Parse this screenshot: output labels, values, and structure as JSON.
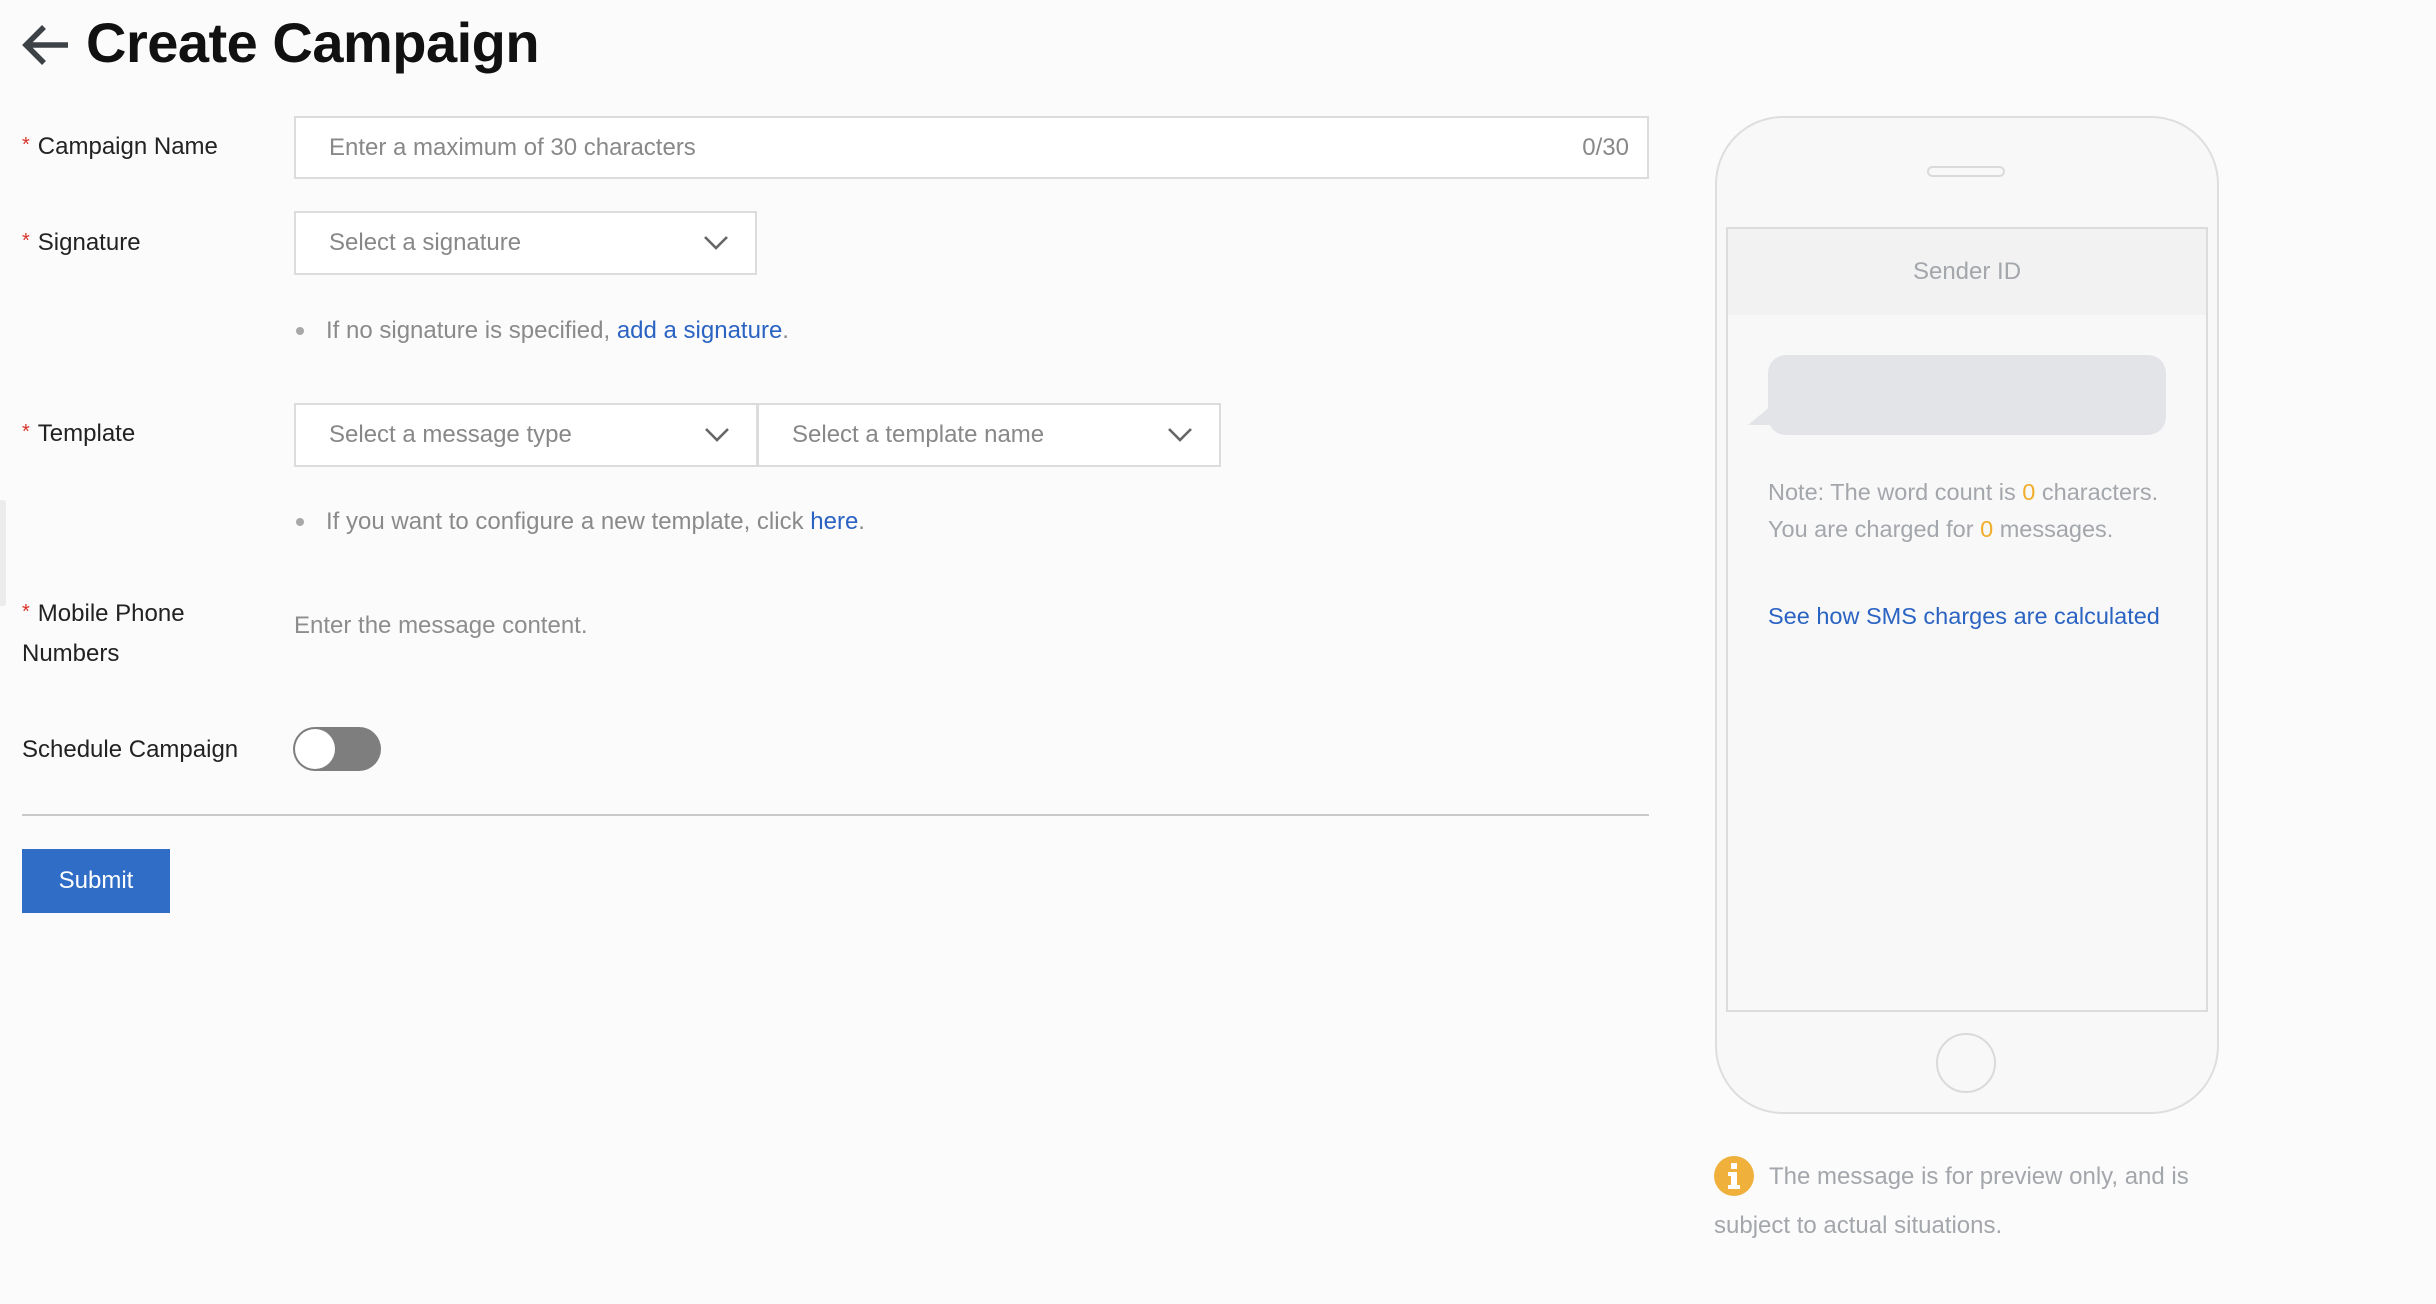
{
  "header": {
    "back_icon": "arrow-left-icon",
    "title": "Create Campaign"
  },
  "form": {
    "required_mark": "*",
    "campaign_name": {
      "label": "Campaign Name",
      "placeholder": "Enter a maximum of 30 characters",
      "value": "",
      "counter": "0/30"
    },
    "signature": {
      "label": "Signature",
      "placeholder": "Select a signature",
      "hint_text": "If no signature is specified, ",
      "hint_link": "add a signature",
      "hint_end": "."
    },
    "template": {
      "label": "Template",
      "type_placeholder": "Select a message type",
      "name_placeholder": "Select a template name",
      "hint_text": "If you want to configure a new template, click ",
      "hint_link": "here",
      "hint_end": "."
    },
    "mobile_numbers": {
      "label_line1": "Mobile Phone",
      "label_line2": "Numbers",
      "placeholder": "Enter the message content."
    },
    "schedule": {
      "label": "Schedule Campaign",
      "enabled": false
    },
    "submit_label": "Submit"
  },
  "preview": {
    "sender_id": "Sender ID",
    "note_prefix": "Note: The word count is ",
    "word_count": "0",
    "note_middle": " characters. You are charged for ",
    "message_count": "0",
    "note_suffix": " messages.",
    "charges_link": "See how SMS charges are calculated",
    "info_icon": "info-icon",
    "disclaimer": "The message is for preview only, and is subject to actual situations."
  },
  "colors": {
    "primary": "#2f6dc6",
    "link": "#2a63c2",
    "required": "#d93026",
    "highlight": "#f0ad2b"
  }
}
